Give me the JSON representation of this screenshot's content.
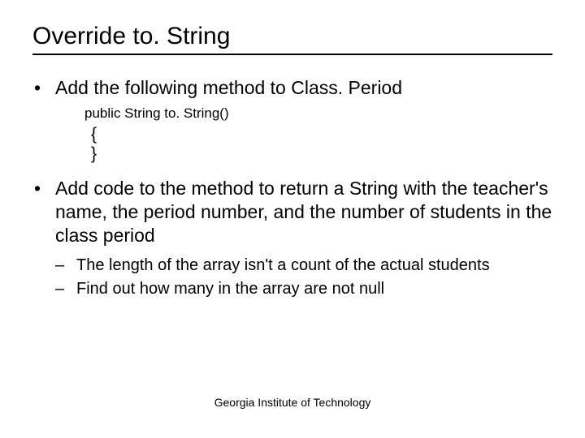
{
  "title": "Override to. String",
  "bullets": [
    {
      "text": "Add the following method to Class. Period",
      "code": {
        "signature": "public String to. String()",
        "brace_open": "{",
        "brace_close": "}"
      }
    },
    {
      "text": "Add code to the method to return a String with the teacher's name, the period number, and the number of students in the class period",
      "sub": [
        "The length of the array isn't a count of the actual students",
        "Find out how many in the array are not null"
      ]
    }
  ],
  "footer": "Georgia Institute of Technology"
}
